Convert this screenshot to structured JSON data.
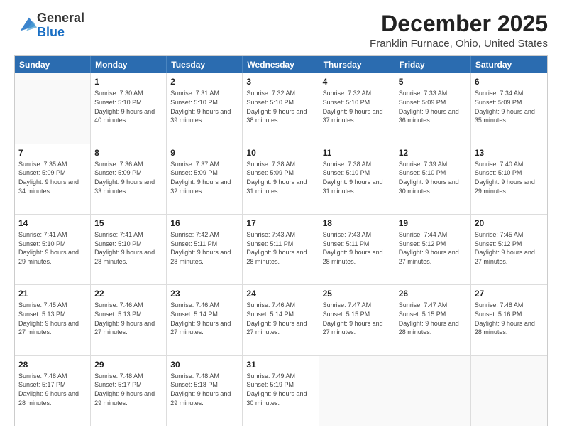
{
  "logo": {
    "line1": "General",
    "line2": "Blue"
  },
  "title": "December 2025",
  "subtitle": "Franklin Furnace, Ohio, United States",
  "days": [
    "Sunday",
    "Monday",
    "Tuesday",
    "Wednesday",
    "Thursday",
    "Friday",
    "Saturday"
  ],
  "weeks": [
    [
      {
        "day": "",
        "sunrise": "",
        "sunset": "",
        "daylight": ""
      },
      {
        "day": "1",
        "sunrise": "Sunrise: 7:30 AM",
        "sunset": "Sunset: 5:10 PM",
        "daylight": "Daylight: 9 hours and 40 minutes."
      },
      {
        "day": "2",
        "sunrise": "Sunrise: 7:31 AM",
        "sunset": "Sunset: 5:10 PM",
        "daylight": "Daylight: 9 hours and 39 minutes."
      },
      {
        "day": "3",
        "sunrise": "Sunrise: 7:32 AM",
        "sunset": "Sunset: 5:10 PM",
        "daylight": "Daylight: 9 hours and 38 minutes."
      },
      {
        "day": "4",
        "sunrise": "Sunrise: 7:32 AM",
        "sunset": "Sunset: 5:10 PM",
        "daylight": "Daylight: 9 hours and 37 minutes."
      },
      {
        "day": "5",
        "sunrise": "Sunrise: 7:33 AM",
        "sunset": "Sunset: 5:09 PM",
        "daylight": "Daylight: 9 hours and 36 minutes."
      },
      {
        "day": "6",
        "sunrise": "Sunrise: 7:34 AM",
        "sunset": "Sunset: 5:09 PM",
        "daylight": "Daylight: 9 hours and 35 minutes."
      }
    ],
    [
      {
        "day": "7",
        "sunrise": "Sunrise: 7:35 AM",
        "sunset": "Sunset: 5:09 PM",
        "daylight": "Daylight: 9 hours and 34 minutes."
      },
      {
        "day": "8",
        "sunrise": "Sunrise: 7:36 AM",
        "sunset": "Sunset: 5:09 PM",
        "daylight": "Daylight: 9 hours and 33 minutes."
      },
      {
        "day": "9",
        "sunrise": "Sunrise: 7:37 AM",
        "sunset": "Sunset: 5:09 PM",
        "daylight": "Daylight: 9 hours and 32 minutes."
      },
      {
        "day": "10",
        "sunrise": "Sunrise: 7:38 AM",
        "sunset": "Sunset: 5:09 PM",
        "daylight": "Daylight: 9 hours and 31 minutes."
      },
      {
        "day": "11",
        "sunrise": "Sunrise: 7:38 AM",
        "sunset": "Sunset: 5:10 PM",
        "daylight": "Daylight: 9 hours and 31 minutes."
      },
      {
        "day": "12",
        "sunrise": "Sunrise: 7:39 AM",
        "sunset": "Sunset: 5:10 PM",
        "daylight": "Daylight: 9 hours and 30 minutes."
      },
      {
        "day": "13",
        "sunrise": "Sunrise: 7:40 AM",
        "sunset": "Sunset: 5:10 PM",
        "daylight": "Daylight: 9 hours and 29 minutes."
      }
    ],
    [
      {
        "day": "14",
        "sunrise": "Sunrise: 7:41 AM",
        "sunset": "Sunset: 5:10 PM",
        "daylight": "Daylight: 9 hours and 29 minutes."
      },
      {
        "day": "15",
        "sunrise": "Sunrise: 7:41 AM",
        "sunset": "Sunset: 5:10 PM",
        "daylight": "Daylight: 9 hours and 28 minutes."
      },
      {
        "day": "16",
        "sunrise": "Sunrise: 7:42 AM",
        "sunset": "Sunset: 5:11 PM",
        "daylight": "Daylight: 9 hours and 28 minutes."
      },
      {
        "day": "17",
        "sunrise": "Sunrise: 7:43 AM",
        "sunset": "Sunset: 5:11 PM",
        "daylight": "Daylight: 9 hours and 28 minutes."
      },
      {
        "day": "18",
        "sunrise": "Sunrise: 7:43 AM",
        "sunset": "Sunset: 5:11 PM",
        "daylight": "Daylight: 9 hours and 28 minutes."
      },
      {
        "day": "19",
        "sunrise": "Sunrise: 7:44 AM",
        "sunset": "Sunset: 5:12 PM",
        "daylight": "Daylight: 9 hours and 27 minutes."
      },
      {
        "day": "20",
        "sunrise": "Sunrise: 7:45 AM",
        "sunset": "Sunset: 5:12 PM",
        "daylight": "Daylight: 9 hours and 27 minutes."
      }
    ],
    [
      {
        "day": "21",
        "sunrise": "Sunrise: 7:45 AM",
        "sunset": "Sunset: 5:13 PM",
        "daylight": "Daylight: 9 hours and 27 minutes."
      },
      {
        "day": "22",
        "sunrise": "Sunrise: 7:46 AM",
        "sunset": "Sunset: 5:13 PM",
        "daylight": "Daylight: 9 hours and 27 minutes."
      },
      {
        "day": "23",
        "sunrise": "Sunrise: 7:46 AM",
        "sunset": "Sunset: 5:14 PM",
        "daylight": "Daylight: 9 hours and 27 minutes."
      },
      {
        "day": "24",
        "sunrise": "Sunrise: 7:46 AM",
        "sunset": "Sunset: 5:14 PM",
        "daylight": "Daylight: 9 hours and 27 minutes."
      },
      {
        "day": "25",
        "sunrise": "Sunrise: 7:47 AM",
        "sunset": "Sunset: 5:15 PM",
        "daylight": "Daylight: 9 hours and 27 minutes."
      },
      {
        "day": "26",
        "sunrise": "Sunrise: 7:47 AM",
        "sunset": "Sunset: 5:15 PM",
        "daylight": "Daylight: 9 hours and 28 minutes."
      },
      {
        "day": "27",
        "sunrise": "Sunrise: 7:48 AM",
        "sunset": "Sunset: 5:16 PM",
        "daylight": "Daylight: 9 hours and 28 minutes."
      }
    ],
    [
      {
        "day": "28",
        "sunrise": "Sunrise: 7:48 AM",
        "sunset": "Sunset: 5:17 PM",
        "daylight": "Daylight: 9 hours and 28 minutes."
      },
      {
        "day": "29",
        "sunrise": "Sunrise: 7:48 AM",
        "sunset": "Sunset: 5:17 PM",
        "daylight": "Daylight: 9 hours and 29 minutes."
      },
      {
        "day": "30",
        "sunrise": "Sunrise: 7:48 AM",
        "sunset": "Sunset: 5:18 PM",
        "daylight": "Daylight: 9 hours and 29 minutes."
      },
      {
        "day": "31",
        "sunrise": "Sunrise: 7:49 AM",
        "sunset": "Sunset: 5:19 PM",
        "daylight": "Daylight: 9 hours and 30 minutes."
      },
      {
        "day": "",
        "sunrise": "",
        "sunset": "",
        "daylight": ""
      },
      {
        "day": "",
        "sunrise": "",
        "sunset": "",
        "daylight": ""
      },
      {
        "day": "",
        "sunrise": "",
        "sunset": "",
        "daylight": ""
      }
    ]
  ]
}
